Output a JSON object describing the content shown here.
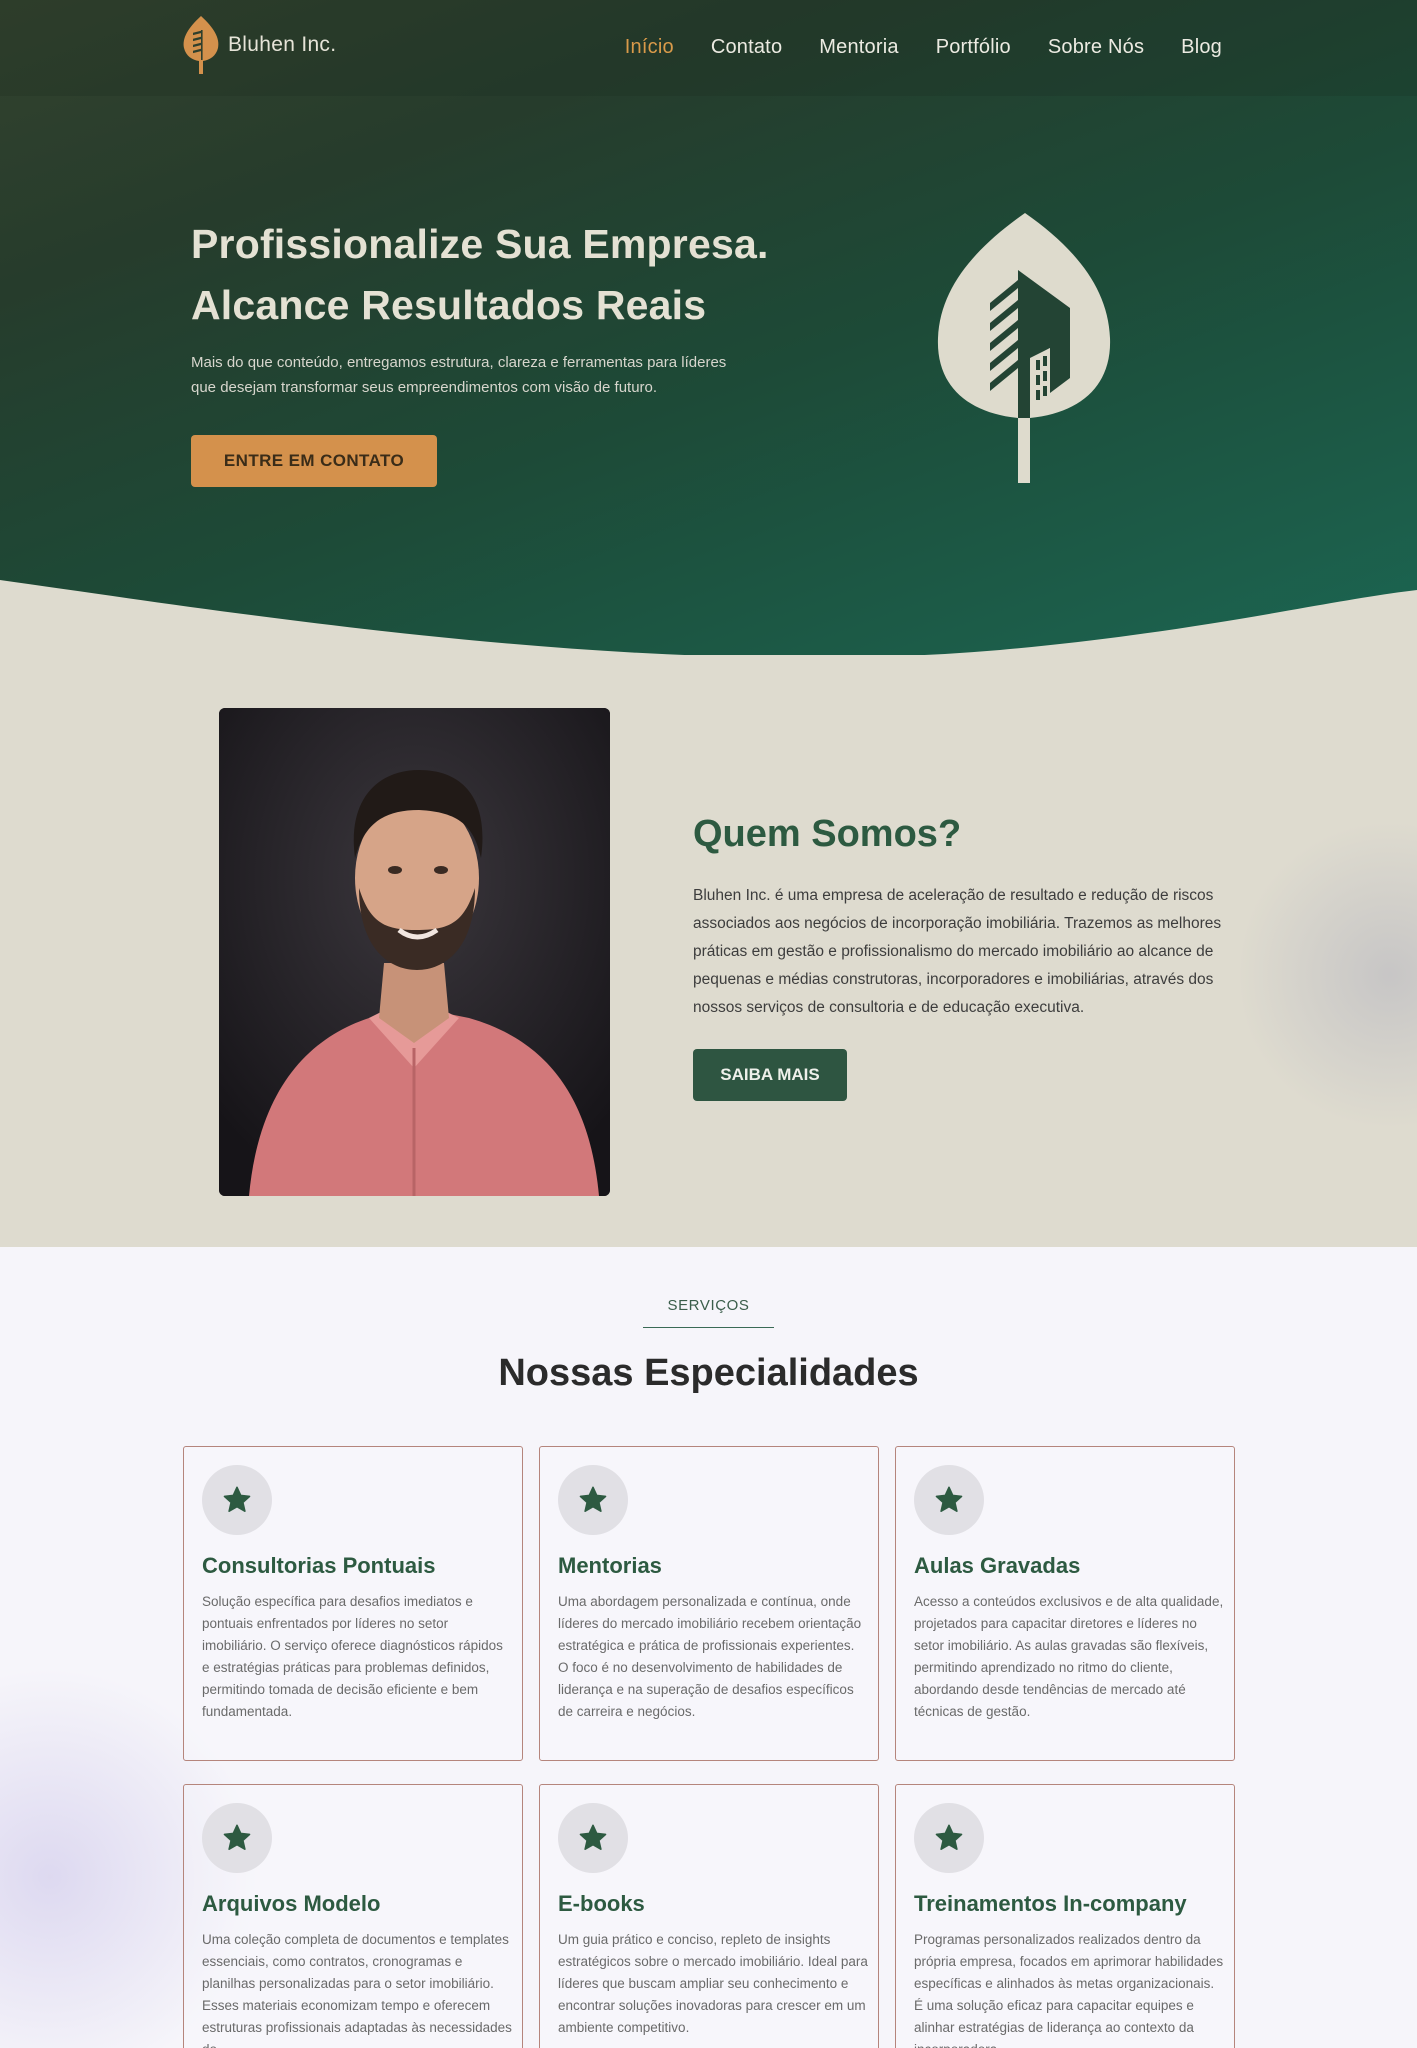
{
  "brand": {
    "name": "Bluhen Inc."
  },
  "nav": {
    "items": [
      {
        "label": "Início",
        "active": true
      },
      {
        "label": "Contato",
        "active": false
      },
      {
        "label": "Mentoria",
        "active": false
      },
      {
        "label": "Portfólio",
        "active": false
      },
      {
        "label": "Sobre Nós",
        "active": false
      },
      {
        "label": "Blog",
        "active": false
      }
    ]
  },
  "hero": {
    "title_line1": "Profissionalize Sua Empresa.",
    "title_line2": "Alcance Resultados Reais",
    "text_line1": "Mais do que conteúdo, entregamos estrutura, clareza e ferramentas para líderes",
    "text_line2": "que desejam transformar seus empreendimentos com visão de futuro.",
    "cta": "ENTRE EM CONTATO"
  },
  "about": {
    "title": "Quem Somos?",
    "text": "Bluhen Inc. é uma empresa de aceleração de resultado e redução de riscos associados aos negócios de incorporação imobiliária. Trazemos as melhores práticas em gestão e profissionalismo do mercado imobiliário ao alcance de pequenas e médias construtoras, incorporadores e imobiliárias, através dos nossos serviços de consultoria e de educação executiva.",
    "cta": "SAIBA MAIS"
  },
  "services": {
    "kicker": "SERVIÇOS",
    "title": "Nossas Especialidades",
    "cards": [
      {
        "icon": "star-icon",
        "title": "Consultorias Pontuais",
        "text": "Solução específica para desafios imediatos e pontuais enfrentados por líderes no setor imobiliário. O serviço oferece diagnósticos rápidos e estratégias práticas para problemas definidos, permitindo tomada de decisão eficiente e bem fundamentada."
      },
      {
        "icon": "star-icon",
        "title": "Mentorias",
        "text": "Uma abordagem personalizada e contínua, onde líderes do mercado imobiliário recebem orientação estratégica e prática de profissionais experientes. O foco é no desenvolvimento de habilidades de liderança e na superação de desafios específicos de carreira e negócios."
      },
      {
        "icon": "star-icon",
        "title": "Aulas Gravadas",
        "text": "Acesso a conteúdos exclusivos e de alta qualidade, projetados para capacitar diretores e líderes no setor imobiliário. As aulas gravadas são flexíveis, permitindo aprendizado no ritmo do cliente, abordando desde tendências de mercado até técnicas de gestão."
      },
      {
        "icon": "star-icon",
        "title": "Arquivos Modelo",
        "text": "Uma coleção completa de documentos e templates essenciais, como contratos, cronogramas e planilhas personalizadas para o setor imobiliário. Esses materiais economizam tempo e oferecem estruturas profissionais adaptadas às necessidades do"
      },
      {
        "icon": "star-icon",
        "title": "E-books",
        "text": "Um guia prático e conciso, repleto de insights estratégicos sobre o mercado imobiliário. Ideal para líderes que buscam ampliar seu conhecimento e encontrar soluções inovadoras para crescer em um ambiente competitivo."
      },
      {
        "icon": "star-icon",
        "title": "Treinamentos In-company",
        "text": "Programas personalizados realizados dentro da própria empresa, focados em aprimorar habilidades específicas e alinhados às metas organizacionais. É uma solução eficaz para capacitar equipes e alinhar estratégias de liderança ao contexto da incorporadora."
      }
    ]
  },
  "colors": {
    "accent_orange": "#d4914c",
    "brand_green": "#2d5a41",
    "hero_dark": "#263c2c",
    "hero_teal": "#1b6652",
    "about_bg": "#dedbcf",
    "card_border": "#b5857c"
  }
}
